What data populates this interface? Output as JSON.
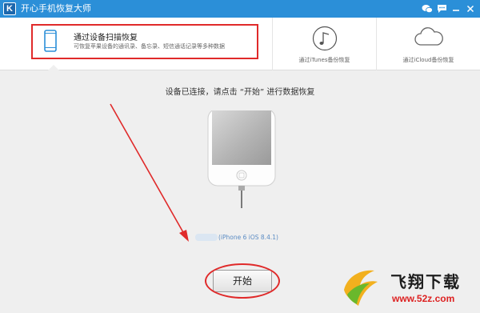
{
  "app": {
    "logo_letter": "K",
    "title": "开心手机恢复大师",
    "controls": [
      "wechat-icon",
      "chat-icon",
      "minimize-icon",
      "close-icon"
    ]
  },
  "tabs": [
    {
      "title": "通过设备扫描恢复",
      "description": "可恢复苹果设备的通讯录、备忘录、短信通话记录等多种数据",
      "icon": "phone-icon",
      "selected": true
    },
    {
      "label": "通过iTunes备份恢复",
      "icon": "music-note-icon",
      "selected": false
    },
    {
      "label": "通过iCloud备份恢复",
      "icon": "cloud-icon",
      "selected": false
    }
  ],
  "main": {
    "prompt": "设备已连接，请点击 “开始” 进行数据恢复",
    "device_name": "(iPhone 6 iOS 8.4.1)",
    "start_label": "开始"
  },
  "watermark": {
    "text": "飞翔下载",
    "url": "www.52z.com"
  },
  "colors": {
    "titlebar": "#2b8fd8",
    "annotation_red": "#e02a2a",
    "background": "#efefef"
  }
}
